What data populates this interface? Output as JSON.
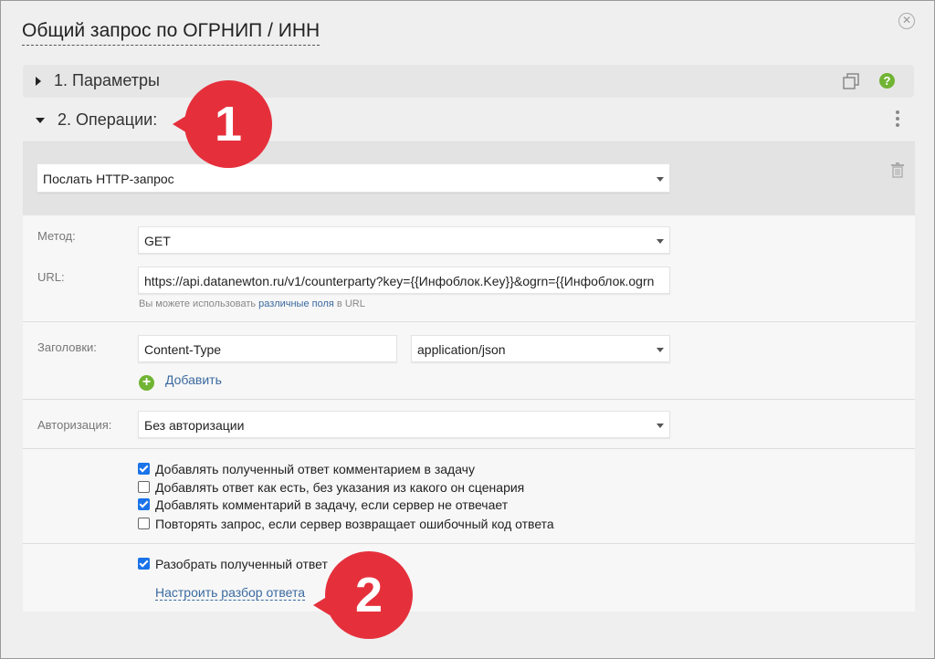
{
  "dialog": {
    "title": "Общий запрос по ОГРНИП / ИНН",
    "close_icon": "close-icon"
  },
  "sections": {
    "params": {
      "label": "1. Параметры",
      "expanded": false
    },
    "operations": {
      "label": "2. Операции:",
      "expanded": true
    }
  },
  "operation": {
    "type_value": "Послать HTTP-запрос",
    "method_label": "Метод:",
    "method_value": "GET",
    "url_label": "URL:",
    "url_value": "https://api.datanewton.ru/v1/counterparty?key={{Инфоблок.Key}}&ogrn={{Инфоблок.ogrn",
    "url_hint_prefix": "Вы можете использовать",
    "url_hint_link": "различные поля",
    "url_hint_suffix": "в URL",
    "headers_label": "Заголовки:",
    "header_name": "Content-Type",
    "header_value": "application/json",
    "add_label": "Добавить",
    "auth_label": "Авторизация:",
    "auth_value": "Без авторизации",
    "options": [
      {
        "label": "Добавлять полученный ответ комментарием в задачу",
        "checked": true
      },
      {
        "label": "Добавлять ответ как есть, без указания из какого он сценария",
        "checked": false
      },
      {
        "label": "Добавлять комментарий в задачу, если сервер не отвечает",
        "checked": true
      },
      {
        "label": "Повторять запрос, если сервер возвращает ошибочный код ответа",
        "checked": false
      }
    ],
    "parse_label": "Разобрать полученный ответ",
    "parse_checked": true,
    "parse_config_link": "Настроить разбор ответа"
  },
  "markers": {
    "first": "1",
    "second": "2"
  },
  "colors": {
    "accent_green": "#71b433",
    "link_blue": "#3b6aa0",
    "marker_red": "#e5303c",
    "checkbox_blue": "#1a73e8"
  }
}
